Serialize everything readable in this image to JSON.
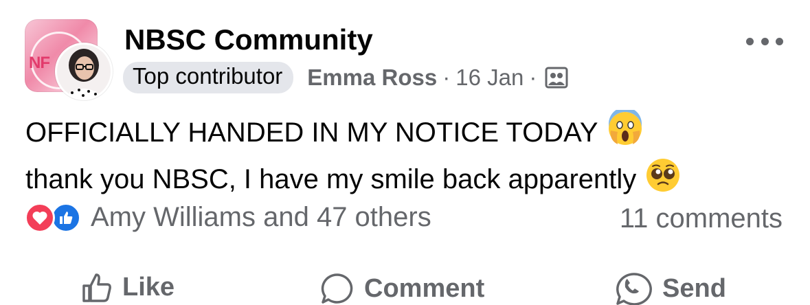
{
  "post": {
    "group_name": "NBSC Community",
    "badge": "Top contributor",
    "author": "Emma Ross",
    "separator": "·",
    "date": "16 Jan",
    "group_logo_text": "NF",
    "text_line1": "OFFICIALLY HANDED IN MY NOTICE TODAY",
    "text_line2": "thank you NBSC, I have my smile back apparently",
    "emoji1": "face-screaming-in-fear",
    "emoji2": "pleading-face"
  },
  "reactions": {
    "types": [
      "love",
      "like"
    ],
    "summary": "Amy Williams and 47 others",
    "comments": "11 comments"
  },
  "actions": {
    "like": "Like",
    "comment": "Comment",
    "send": "Send"
  },
  "colors": {
    "secondary_text": "#65676b",
    "badge_bg": "#e4e6eb",
    "love": "#f33e58",
    "like": "#1b74e4"
  },
  "icons": {
    "more": "more-dots-icon",
    "audience": "members-audience-icon"
  }
}
